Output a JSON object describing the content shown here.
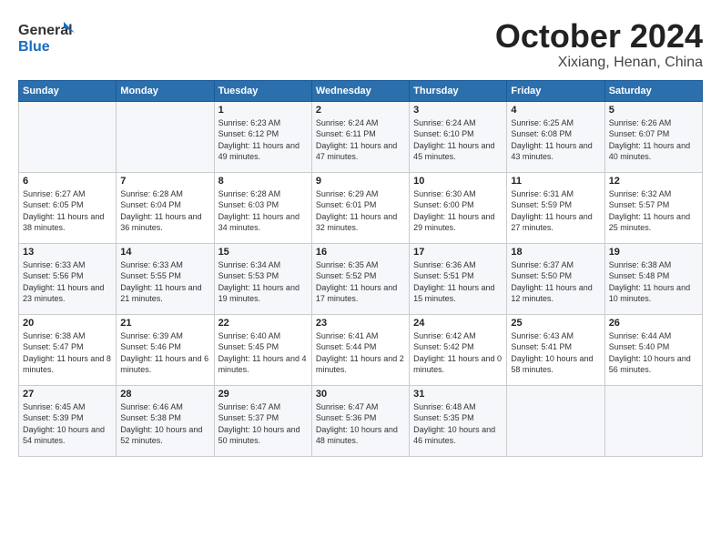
{
  "logo": {
    "line1": "General",
    "line2": "Blue"
  },
  "title": "October 2024",
  "location": "Xixiang, Henan, China",
  "header_days": [
    "Sunday",
    "Monday",
    "Tuesday",
    "Wednesday",
    "Thursday",
    "Friday",
    "Saturday"
  ],
  "weeks": [
    [
      {
        "day": "",
        "info": ""
      },
      {
        "day": "",
        "info": ""
      },
      {
        "day": "1",
        "info": "Sunrise: 6:23 AM\nSunset: 6:12 PM\nDaylight: 11 hours and 49 minutes."
      },
      {
        "day": "2",
        "info": "Sunrise: 6:24 AM\nSunset: 6:11 PM\nDaylight: 11 hours and 47 minutes."
      },
      {
        "day": "3",
        "info": "Sunrise: 6:24 AM\nSunset: 6:10 PM\nDaylight: 11 hours and 45 minutes."
      },
      {
        "day": "4",
        "info": "Sunrise: 6:25 AM\nSunset: 6:08 PM\nDaylight: 11 hours and 43 minutes."
      },
      {
        "day": "5",
        "info": "Sunrise: 6:26 AM\nSunset: 6:07 PM\nDaylight: 11 hours and 40 minutes."
      }
    ],
    [
      {
        "day": "6",
        "info": "Sunrise: 6:27 AM\nSunset: 6:05 PM\nDaylight: 11 hours and 38 minutes."
      },
      {
        "day": "7",
        "info": "Sunrise: 6:28 AM\nSunset: 6:04 PM\nDaylight: 11 hours and 36 minutes."
      },
      {
        "day": "8",
        "info": "Sunrise: 6:28 AM\nSunset: 6:03 PM\nDaylight: 11 hours and 34 minutes."
      },
      {
        "day": "9",
        "info": "Sunrise: 6:29 AM\nSunset: 6:01 PM\nDaylight: 11 hours and 32 minutes."
      },
      {
        "day": "10",
        "info": "Sunrise: 6:30 AM\nSunset: 6:00 PM\nDaylight: 11 hours and 29 minutes."
      },
      {
        "day": "11",
        "info": "Sunrise: 6:31 AM\nSunset: 5:59 PM\nDaylight: 11 hours and 27 minutes."
      },
      {
        "day": "12",
        "info": "Sunrise: 6:32 AM\nSunset: 5:57 PM\nDaylight: 11 hours and 25 minutes."
      }
    ],
    [
      {
        "day": "13",
        "info": "Sunrise: 6:33 AM\nSunset: 5:56 PM\nDaylight: 11 hours and 23 minutes."
      },
      {
        "day": "14",
        "info": "Sunrise: 6:33 AM\nSunset: 5:55 PM\nDaylight: 11 hours and 21 minutes."
      },
      {
        "day": "15",
        "info": "Sunrise: 6:34 AM\nSunset: 5:53 PM\nDaylight: 11 hours and 19 minutes."
      },
      {
        "day": "16",
        "info": "Sunrise: 6:35 AM\nSunset: 5:52 PM\nDaylight: 11 hours and 17 minutes."
      },
      {
        "day": "17",
        "info": "Sunrise: 6:36 AM\nSunset: 5:51 PM\nDaylight: 11 hours and 15 minutes."
      },
      {
        "day": "18",
        "info": "Sunrise: 6:37 AM\nSunset: 5:50 PM\nDaylight: 11 hours and 12 minutes."
      },
      {
        "day": "19",
        "info": "Sunrise: 6:38 AM\nSunset: 5:48 PM\nDaylight: 11 hours and 10 minutes."
      }
    ],
    [
      {
        "day": "20",
        "info": "Sunrise: 6:38 AM\nSunset: 5:47 PM\nDaylight: 11 hours and 8 minutes."
      },
      {
        "day": "21",
        "info": "Sunrise: 6:39 AM\nSunset: 5:46 PM\nDaylight: 11 hours and 6 minutes."
      },
      {
        "day": "22",
        "info": "Sunrise: 6:40 AM\nSunset: 5:45 PM\nDaylight: 11 hours and 4 minutes."
      },
      {
        "day": "23",
        "info": "Sunrise: 6:41 AM\nSunset: 5:44 PM\nDaylight: 11 hours and 2 minutes."
      },
      {
        "day": "24",
        "info": "Sunrise: 6:42 AM\nSunset: 5:42 PM\nDaylight: 11 hours and 0 minutes."
      },
      {
        "day": "25",
        "info": "Sunrise: 6:43 AM\nSunset: 5:41 PM\nDaylight: 10 hours and 58 minutes."
      },
      {
        "day": "26",
        "info": "Sunrise: 6:44 AM\nSunset: 5:40 PM\nDaylight: 10 hours and 56 minutes."
      }
    ],
    [
      {
        "day": "27",
        "info": "Sunrise: 6:45 AM\nSunset: 5:39 PM\nDaylight: 10 hours and 54 minutes."
      },
      {
        "day": "28",
        "info": "Sunrise: 6:46 AM\nSunset: 5:38 PM\nDaylight: 10 hours and 52 minutes."
      },
      {
        "day": "29",
        "info": "Sunrise: 6:47 AM\nSunset: 5:37 PM\nDaylight: 10 hours and 50 minutes."
      },
      {
        "day": "30",
        "info": "Sunrise: 6:47 AM\nSunset: 5:36 PM\nDaylight: 10 hours and 48 minutes."
      },
      {
        "day": "31",
        "info": "Sunrise: 6:48 AM\nSunset: 5:35 PM\nDaylight: 10 hours and 46 minutes."
      },
      {
        "day": "",
        "info": ""
      },
      {
        "day": "",
        "info": ""
      }
    ]
  ]
}
